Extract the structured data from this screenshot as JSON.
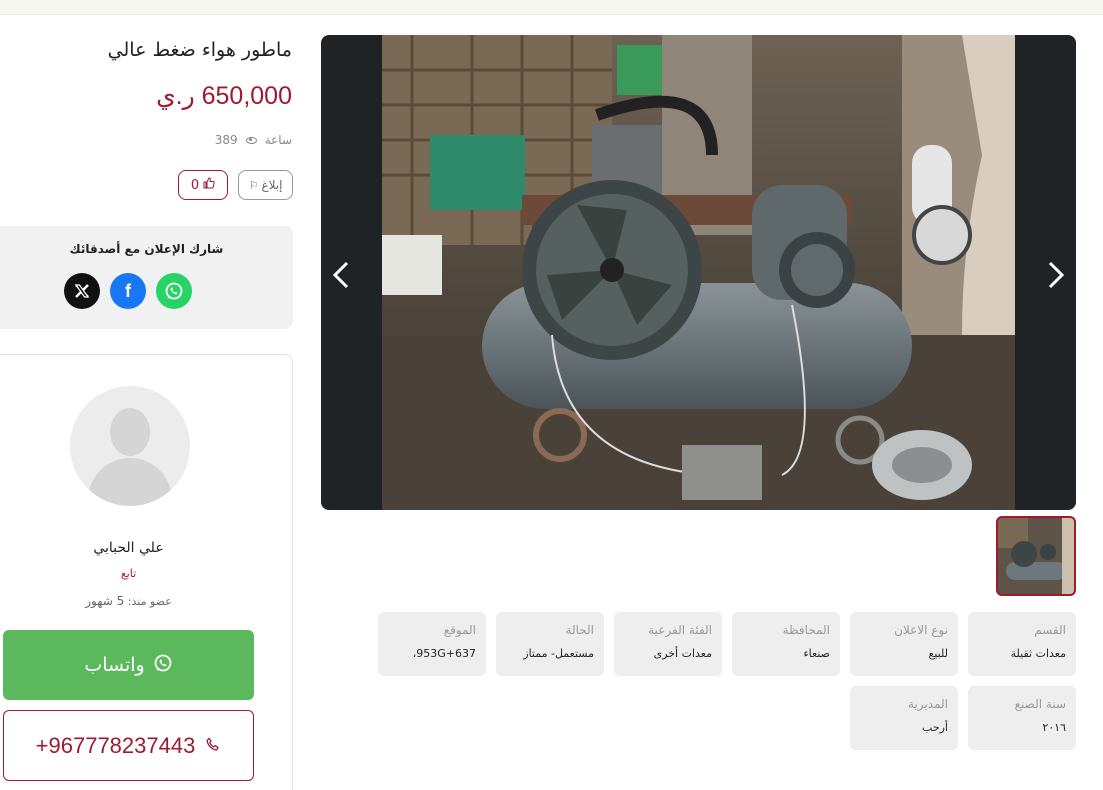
{
  "listing": {
    "title": "ماطور هواء ضغط عالي",
    "price": "650,000 ر.ي",
    "time_label": "ساعة",
    "views": "389"
  },
  "actions": {
    "report_label": "إبلاغ",
    "likes": "0"
  },
  "share": {
    "title": "شارك الإعلان مع أصدقائك",
    "icons": [
      "whatsapp-icon",
      "facebook-icon",
      "x-icon"
    ]
  },
  "seller": {
    "name": "علي الحبابي",
    "type": "تابع",
    "member_label": "عضو منذ:",
    "member_duration": "5 شهور"
  },
  "contact": {
    "whatsapp_label": "واتساب",
    "phone": "+967778237443"
  },
  "details": [
    {
      "label": "القسم",
      "value": "معدات ثقيلة"
    },
    {
      "label": "نوع الاعلان",
      "value": "للبيع"
    },
    {
      "label": "المحافظة",
      "value": "صنعاء"
    },
    {
      "label": "الفئة الفرعية",
      "value": "معدات أخرى"
    },
    {
      "label": "الحالة",
      "value": "مستعمل- ممتاز"
    },
    {
      "label": "الموقع",
      "value": "953G+637،"
    },
    {
      "label": "سنة الصنع",
      "value": "٢٠١٦"
    },
    {
      "label": "المديرية",
      "value": "أرحب"
    }
  ],
  "colors": {
    "accent": "#9b1c31",
    "whatsapp_green": "#5cb85c",
    "card_bg": "#eeeeee"
  }
}
